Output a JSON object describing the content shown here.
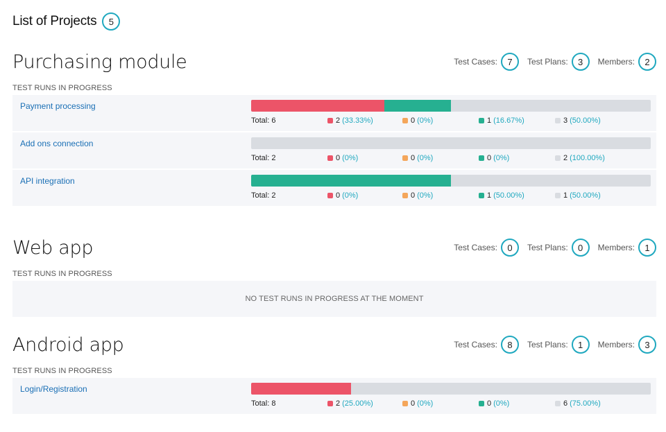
{
  "header": {
    "title": "List of Projects",
    "count": "5"
  },
  "labels": {
    "test_cases": "Test Cases:",
    "test_plans": "Test Plans:",
    "members": "Members:",
    "runs_section": "TEST RUNS IN PROGRESS",
    "no_runs": "NO TEST RUNS IN PROGRESS AT THE MOMENT",
    "total_prefix": "Total:"
  },
  "colors": {
    "failed": "#ec5468",
    "blocked": "#f4a65b",
    "passed": "#26b091",
    "untested": "#d9dce1",
    "accent": "#1fa8bf",
    "link": "#1a6fb5"
  },
  "projects": [
    {
      "name": "Purchasing module",
      "test_cases": "7",
      "test_plans": "3",
      "members": "2",
      "runs": [
        {
          "name": "Payment processing",
          "total": "Total: 6",
          "failed": {
            "count": "2",
            "pct": "(33.33%)",
            "fraction": 0.3333
          },
          "blocked": {
            "count": "0",
            "pct": "(0%)",
            "fraction": 0
          },
          "passed": {
            "count": "1",
            "pct": "(16.67%)",
            "fraction": 0.1667
          },
          "untested": {
            "count": "3",
            "pct": "(50.00%)",
            "fraction": 0.5
          }
        },
        {
          "name": "Add ons connection",
          "total": "Total: 2",
          "failed": {
            "count": "0",
            "pct": "(0%)",
            "fraction": 0
          },
          "blocked": {
            "count": "0",
            "pct": "(0%)",
            "fraction": 0
          },
          "passed": {
            "count": "0",
            "pct": "(0%)",
            "fraction": 0
          },
          "untested": {
            "count": "2",
            "pct": "(100.00%)",
            "fraction": 1.0
          }
        },
        {
          "name": "API integration",
          "total": "Total: 2",
          "failed": {
            "count": "0",
            "pct": "(0%)",
            "fraction": 0
          },
          "blocked": {
            "count": "0",
            "pct": "(0%)",
            "fraction": 0
          },
          "passed": {
            "count": "1",
            "pct": "(50.00%)",
            "fraction": 0.5
          },
          "untested": {
            "count": "1",
            "pct": "(50.00%)",
            "fraction": 0.5
          }
        }
      ]
    },
    {
      "name": "Web app",
      "test_cases": "0",
      "test_plans": "0",
      "members": "1",
      "runs": []
    },
    {
      "name": "Android app",
      "test_cases": "8",
      "test_plans": "1",
      "members": "3",
      "runs": [
        {
          "name": "Login/Registration",
          "total": "Total: 8",
          "failed": {
            "count": "2",
            "pct": "(25.00%)",
            "fraction": 0.25
          },
          "blocked": {
            "count": "0",
            "pct": "(0%)",
            "fraction": 0
          },
          "passed": {
            "count": "0",
            "pct": "(0%)",
            "fraction": 0
          },
          "untested": {
            "count": "6",
            "pct": "(75.00%)",
            "fraction": 0.75
          }
        }
      ]
    }
  ]
}
